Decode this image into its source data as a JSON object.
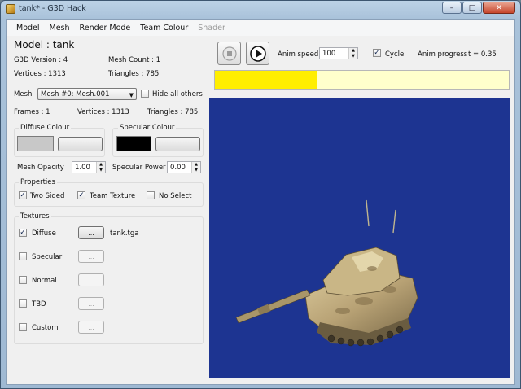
{
  "window": {
    "title": "tank* - G3D Hack",
    "minimize": "–",
    "maximize": "□",
    "close": "✕"
  },
  "menu": [
    {
      "label": "Model",
      "enabled": true
    },
    {
      "label": "Mesh",
      "enabled": true
    },
    {
      "label": "Render Mode",
      "enabled": true
    },
    {
      "label": "Team Colour",
      "enabled": true
    },
    {
      "label": "Shader",
      "enabled": false
    }
  ],
  "model": {
    "title": "Model : tank",
    "g3d_version": "G3D Version : 4",
    "mesh_count": "Mesh Count : 1",
    "vertices": "Vertices : 1313",
    "triangles": "Triangles : 785"
  },
  "mesh": {
    "label": "Mesh",
    "selected": "Mesh #0: Mesh.001",
    "hide_all_others": "Hide all others",
    "frames": "Frames : 1",
    "vertices": "Vertices : 1313",
    "triangles": "Triangles : 785"
  },
  "colours": {
    "diffuse_title": "Diffuse Colour",
    "diffuse_color": "#c8c8c8",
    "diffuse_button": "...",
    "specular_title": "Specular Colour",
    "specular_color": "#000000",
    "specular_button": "..."
  },
  "opacity": {
    "label": "Mesh Opacity",
    "value": "1.00"
  },
  "specular_power": {
    "label": "Specular Power",
    "value": "0.00"
  },
  "properties": {
    "title": "Properties",
    "items": [
      {
        "label": "Two Sided",
        "checked": true
      },
      {
        "label": "Team Texture",
        "checked": true
      },
      {
        "label": "No Select",
        "checked": false
      }
    ]
  },
  "textures": {
    "title": "Textures",
    "items": [
      {
        "label": "Diffuse",
        "checked": true,
        "button": "...",
        "enabled": true,
        "file": "tank.tga"
      },
      {
        "label": "Specular",
        "checked": false,
        "button": "...",
        "enabled": false,
        "file": ""
      },
      {
        "label": "Normal",
        "checked": false,
        "button": "...",
        "enabled": false,
        "file": ""
      },
      {
        "label": "TBD",
        "checked": false,
        "button": "...",
        "enabled": false,
        "file": ""
      },
      {
        "label": "Custom",
        "checked": false,
        "button": "...",
        "enabled": false,
        "file": ""
      }
    ]
  },
  "anim": {
    "speed_label": "Anim speed",
    "speed_value": "100",
    "cycle_label": "Cycle",
    "cycle_checked": true,
    "progress_label": "Anim progress",
    "t_label": "t = 0.35",
    "progress": 0.35
  },
  "viewport": {
    "background": "#1d3491"
  }
}
